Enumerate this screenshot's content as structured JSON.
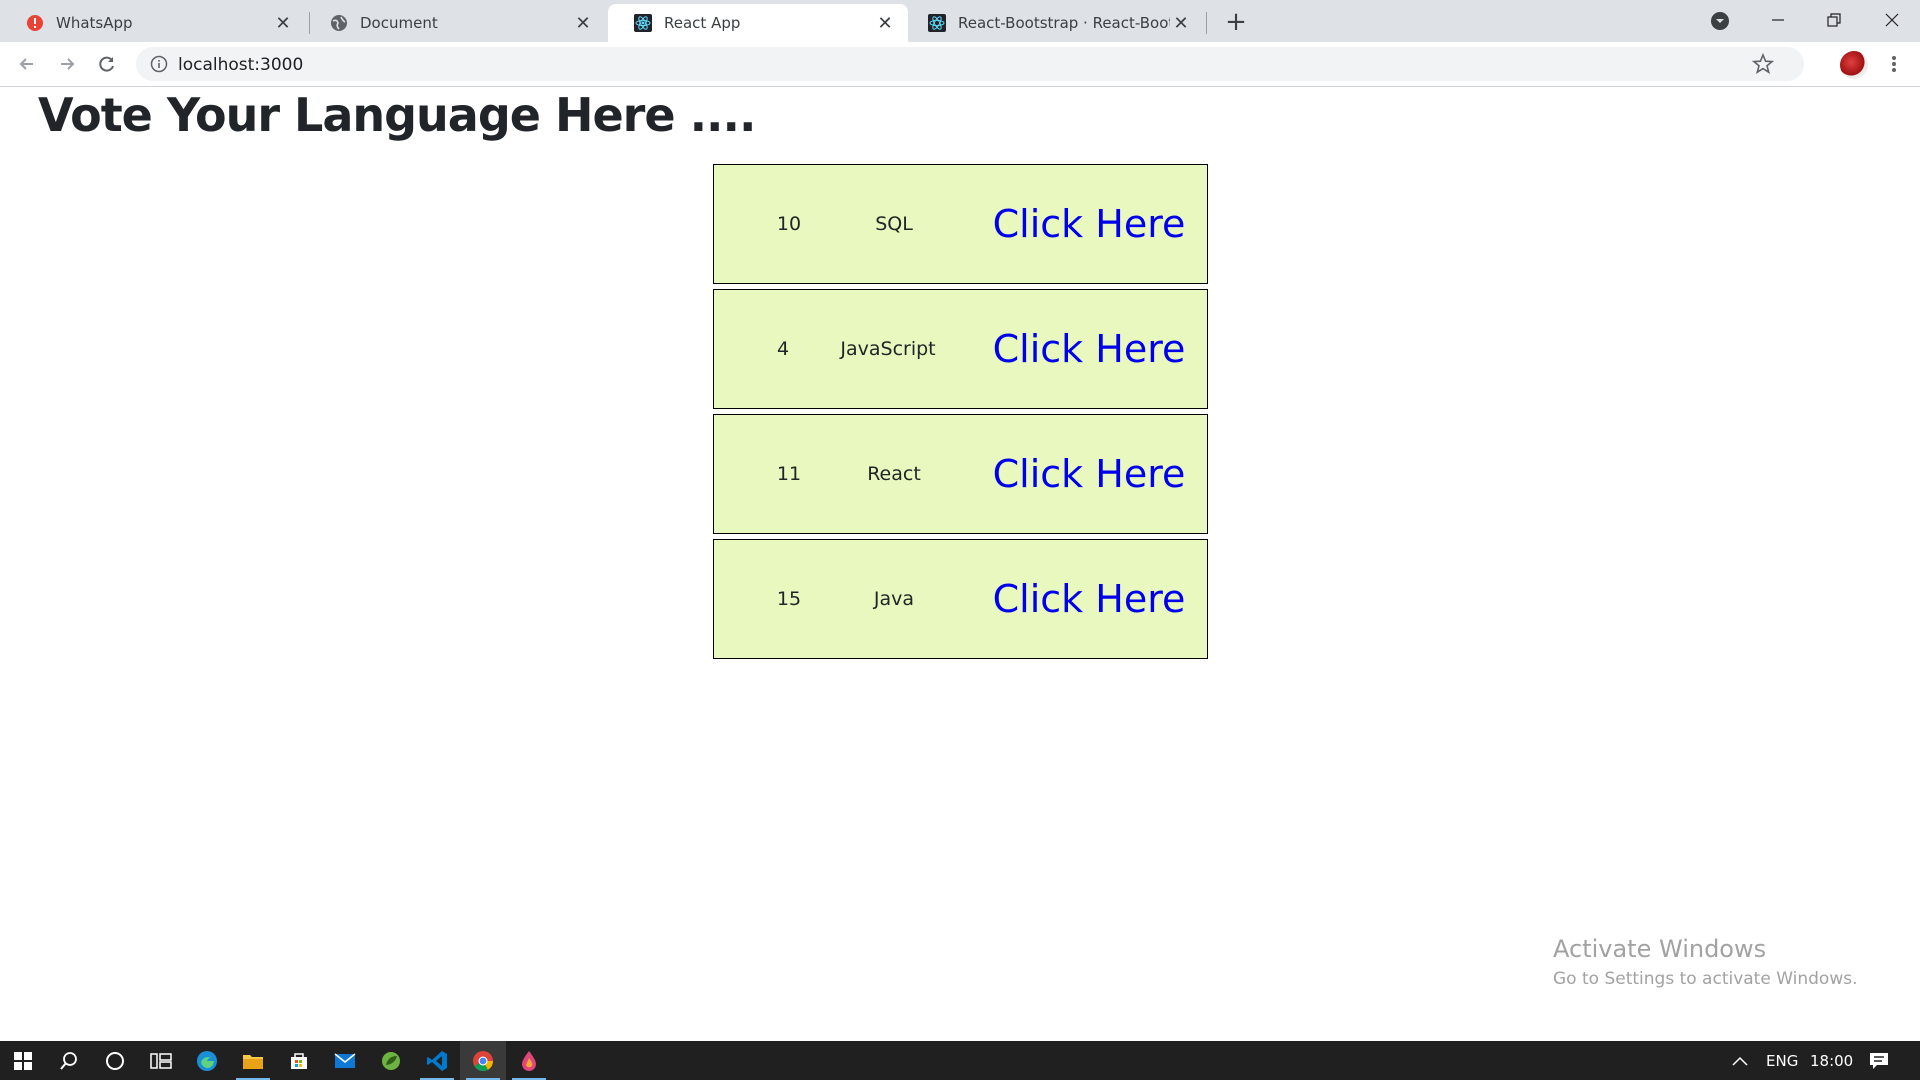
{
  "browser": {
    "tabs": [
      {
        "title": "WhatsApp",
        "icon": "whatsapp-alert-icon",
        "active": false
      },
      {
        "title": "Document",
        "icon": "globe-icon",
        "active": false
      },
      {
        "title": "React App",
        "icon": "react-icon",
        "active": true
      },
      {
        "title": "React-Bootstrap · React-Bootstrap",
        "icon": "react-bootstrap-icon",
        "active": false
      }
    ],
    "new_tab_label": "+",
    "url": "localhost:3000"
  },
  "page": {
    "title": "Vote Your Language Here ....",
    "languages": [
      {
        "votes": "10",
        "name": "SQL",
        "action": "Click Here"
      },
      {
        "votes": "4",
        "name": "JavaScript",
        "action": "Click Here"
      },
      {
        "votes": "11",
        "name": "React",
        "action": "Click Here"
      },
      {
        "votes": "15",
        "name": "Java",
        "action": "Click Here"
      }
    ],
    "colors": {
      "card_bg": "#e8f8be",
      "link": "#0000ee",
      "title": "#212529"
    }
  },
  "watermark": {
    "line1": "Activate Windows",
    "line2": "Go to Settings to activate Windows."
  },
  "taskbar": {
    "icons": [
      "windows-start-icon",
      "search-icon",
      "cortana-icon",
      "task-view-icon",
      "edge-icon",
      "file-explorer-icon",
      "store-icon",
      "mail-icon",
      "spring-tool-icon",
      "vscode-icon",
      "chrome-icon",
      "paint-drop-icon"
    ],
    "language": "ENG",
    "time": "18:00"
  }
}
